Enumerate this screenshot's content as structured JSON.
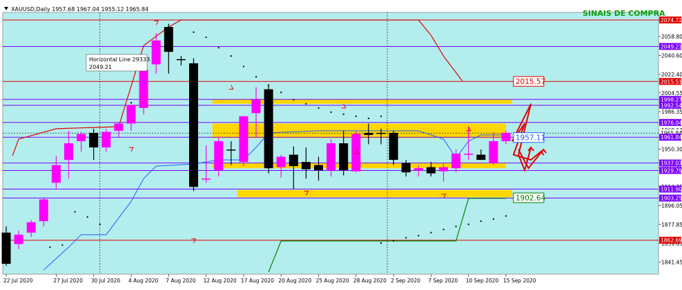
{
  "header": {
    "symbol_info": "XAUUSD,Daily  1957.68 1967.04 1955.12 1965.84",
    "signal_text": "SINAIS DE COMPRA"
  },
  "tooltip": {
    "line1": "Horizontal Line 29333",
    "line2": "2049.21"
  },
  "colors": {
    "background": "#b4eded",
    "bull": "#ff00ff",
    "bear": "#000000",
    "zone": "#ffd700",
    "red_line": "#e00000",
    "purple_line": "#7b00ff",
    "green_line": "#008000",
    "blue_line": "#1f5fff"
  },
  "chart_data": {
    "type": "candlestick",
    "ylim": [
      1830,
      2082
    ],
    "y_ticks": [
      "2074.72",
      "2058.80",
      "2040.60",
      "2022.40",
      "2004.55",
      "1986.35",
      "1968.50",
      "1950.30",
      "1932.45",
      "1914.25",
      "1896.05",
      "1877.85",
      "1859.65",
      "1841.45"
    ],
    "x_tick_labels": [
      {
        "i": 0,
        "label": "22 Jul 2020"
      },
      {
        "i": 4,
        "label": "27 Jul 2020"
      },
      {
        "i": 7,
        "label": "30 Jul 2020"
      },
      {
        "i": 10,
        "label": "4 Aug 2020"
      },
      {
        "i": 13,
        "label": "7 Aug 2020"
      },
      {
        "i": 16,
        "label": "12 Aug 2020"
      },
      {
        "i": 19,
        "label": "17 Aug 2020"
      },
      {
        "i": 22,
        "label": "20 Aug 2020"
      },
      {
        "i": 25,
        "label": "25 Aug 2020"
      },
      {
        "i": 28,
        "label": "28 Aug 2020"
      },
      {
        "i": 31,
        "label": "2 Sep 2020"
      },
      {
        "i": 34,
        "label": "7 Sep 2020"
      },
      {
        "i": 37,
        "label": "10 Sep 2020"
      },
      {
        "i": 40,
        "label": "15 Sep 2020"
      }
    ],
    "candles": [
      [
        1870,
        1876,
        1838,
        1840
      ],
      [
        1859,
        1872,
        1854,
        1868
      ],
      [
        1870,
        1882,
        1866,
        1880
      ],
      [
        1881,
        1904,
        1876,
        1902
      ],
      [
        1918,
        1944,
        1912,
        1935
      ],
      [
        1940,
        1968,
        1922,
        1956
      ],
      [
        1958,
        1967,
        1948,
        1965
      ],
      [
        1966,
        1970,
        1940,
        1952
      ],
      [
        1952,
        1970,
        1948,
        1967
      ],
      [
        1968,
        1975,
        1962,
        1975
      ],
      [
        1975,
        1993,
        1968,
        1993
      ],
      [
        1990,
        2030,
        1984,
        2027
      ],
      [
        2032,
        2062,
        2023,
        2055
      ],
      [
        2068,
        2071,
        2023,
        2044
      ],
      [
        2037,
        2040,
        2031,
        2036
      ],
      [
        2033,
        2038,
        1910,
        1914
      ],
      [
        1921,
        1954,
        1918,
        1922
      ],
      [
        1930,
        1962,
        1924,
        1958
      ],
      [
        1950,
        1958,
        1935,
        1949
      ],
      [
        1938,
        1982,
        1934,
        1982
      ],
      [
        1985,
        2010,
        1962,
        1998
      ],
      [
        2008,
        2012,
        1927,
        1932
      ],
      [
        1933,
        1945,
        1923,
        1943
      ],
      [
        1945,
        1953,
        1912,
        1934
      ],
      [
        1938,
        1952,
        1922,
        1931
      ],
      [
        1935,
        1943,
        1920,
        1930
      ],
      [
        1930,
        1960,
        1924,
        1956
      ],
      [
        1956,
        1968,
        1925,
        1930
      ],
      [
        1929,
        1968,
        1928,
        1965
      ],
      [
        1966,
        1975,
        1955,
        1964
      ],
      [
        1966,
        1970,
        1955,
        1965
      ],
      [
        1966,
        1968,
        1935,
        1940
      ],
      [
        1937,
        1940,
        1924,
        1928
      ],
      [
        1930,
        1935,
        1924,
        1932
      ],
      [
        1933,
        1938,
        1924,
        1927
      ],
      [
        1929,
        1937,
        1919,
        1933
      ],
      [
        1932,
        1950,
        1928,
        1946
      ],
      [
        1946,
        1972,
        1940,
        1946
      ],
      [
        1945,
        1950,
        1940,
        1940
      ],
      [
        1937,
        1966,
        1935,
        1958
      ],
      [
        1958,
        1968,
        1955,
        1966
      ]
    ],
    "horizontal_lines": [
      {
        "price": 2074.72,
        "color": "red",
        "label": "2074.72",
        "tag": "red"
      },
      {
        "price": 2049.21,
        "color": "purple",
        "label": "2049.21",
        "tag": "purple"
      },
      {
        "price": 2015.51,
        "color": "red",
        "label": "2015.51",
        "tag": "red"
      },
      {
        "price": 1998.27,
        "color": "purple",
        "label": "1998.27",
        "tag": "purple"
      },
      {
        "price": 1992.54,
        "color": "purple",
        "label": "1992.54",
        "tag": "purple"
      },
      {
        "price": 1976.04,
        "color": "purple",
        "label": "1976.04",
        "tag": "purple"
      },
      {
        "price": 1965.84,
        "color": "black",
        "label": "1965.84",
        "tag": "white"
      },
      {
        "price": 1961.84,
        "color": "purple",
        "label": "1961.84",
        "tag": "purple"
      },
      {
        "price": 1937.03,
        "color": "purple",
        "label": "1937.03",
        "tag": "purple"
      },
      {
        "price": 1929.79,
        "color": "purple",
        "label": "1929.79",
        "tag": "purple"
      },
      {
        "price": 1911.9,
        "color": "purple",
        "label": "1911.90",
        "tag": "purple"
      },
      {
        "price": 1903.25,
        "color": "purple",
        "label": "1903.25",
        "tag": "purple"
      },
      {
        "price": 1862.69,
        "color": "red",
        "label": "1862.69",
        "tag": "red"
      }
    ],
    "zones": [
      {
        "top": 1998,
        "bottom": 1994,
        "i0": 16.5,
        "i1": 40.5
      },
      {
        "top": 1975,
        "bottom": 1961,
        "i0": 16.5,
        "i1": 40
      },
      {
        "top": 1937,
        "bottom": 1932,
        "i0": 16.5,
        "i1": 40
      },
      {
        "top": 1911,
        "bottom": 1904,
        "i0": 18.5,
        "i1": 40.5
      }
    ],
    "zone_labels": [
      {
        "text": "2015.57",
        "price": 2015.57,
        "i": 40.6,
        "color": "red"
      },
      {
        "text": "1957.11",
        "price": 1961.5,
        "i": 40.6,
        "color": "blue"
      },
      {
        "text": "1902.64",
        "price": 1903.5,
        "i": 40.6,
        "color": "green"
      }
    ],
    "red_curve": [
      [
        0.5,
        1944
      ],
      [
        1,
        1960
      ],
      [
        4,
        1970
      ],
      [
        9,
        1972
      ],
      [
        11,
        2050
      ],
      [
        13,
        2068
      ],
      [
        14,
        2074.7
      ],
      [
        33,
        2074.7
      ],
      [
        34,
        2060
      ],
      [
        35,
        2040
      ],
      [
        36.5,
        2016
      ]
    ],
    "green_curve": [
      [
        21,
        1832
      ],
      [
        22,
        1862
      ],
      [
        35,
        1862
      ],
      [
        36,
        1862
      ],
      [
        37,
        1903
      ],
      [
        40,
        1903
      ]
    ],
    "blue_curve": [
      [
        3,
        1834
      ],
      [
        5,
        1856
      ],
      [
        6,
        1868
      ],
      [
        8,
        1868
      ],
      [
        10,
        1900
      ],
      [
        11,
        1922
      ],
      [
        12,
        1934
      ],
      [
        15,
        1936
      ],
      [
        16,
        1938
      ],
      [
        17,
        1940
      ],
      [
        19,
        1940
      ],
      [
        20,
        1952
      ],
      [
        21,
        1966
      ],
      [
        25,
        1968
      ],
      [
        30,
        1968
      ],
      [
        33,
        1968
      ],
      [
        35,
        1960
      ],
      [
        36,
        1942
      ],
      [
        37,
        1958
      ],
      [
        38,
        1964
      ],
      [
        40,
        1964
      ]
    ],
    "psar_dots": [
      [
        15,
        2063
      ],
      [
        16,
        2058
      ],
      [
        17,
        2048
      ],
      [
        18,
        2040
      ],
      [
        19,
        2030
      ],
      [
        20,
        2020
      ],
      [
        21,
        2012
      ],
      [
        22,
        2005
      ],
      [
        23,
        1998
      ],
      [
        24,
        1994
      ],
      [
        25,
        1990
      ],
      [
        26,
        1986
      ],
      [
        27,
        1984
      ],
      [
        28,
        1982
      ],
      [
        29,
        1980
      ],
      [
        30,
        1982
      ],
      [
        10,
        1995
      ],
      [
        7.5,
        1878
      ],
      [
        6.5,
        1885
      ],
      [
        5.5,
        1890
      ],
      [
        4.5,
        1858
      ],
      [
        3.5,
        1856
      ],
      [
        30,
        1860
      ],
      [
        31,
        1862
      ],
      [
        32,
        1865
      ],
      [
        33,
        1867
      ],
      [
        34,
        1870
      ],
      [
        35,
        1873
      ],
      [
        36,
        1876
      ],
      [
        37,
        1878
      ],
      [
        38,
        1881
      ],
      [
        39,
        1883
      ],
      [
        40,
        1886
      ]
    ],
    "arrows": [
      {
        "i": 24,
        "price": 1906,
        "dir": "down"
      },
      {
        "i": 35,
        "price": 1903,
        "dir": "down"
      },
      {
        "i": 28,
        "price": 1950,
        "dir": "up"
      },
      {
        "i": 37,
        "price": 1972,
        "dir": "up"
      },
      {
        "i": 15,
        "price": 1860,
        "dir": "down"
      },
      {
        "i": 12,
        "price": 2070,
        "dir": "down"
      },
      {
        "i": 18,
        "price": 2012,
        "dir": "up"
      },
      {
        "i": 27,
        "price": 1994,
        "dir": "up"
      },
      {
        "i": 10,
        "price": 1948,
        "dir": "down"
      }
    ],
    "zigzag": [
      [
        [
          40.5,
          1958
        ],
        [
          42,
          1994
        ],
        [
          41,
          1945
        ],
        [
          41.5,
          1930
        ],
        [
          42,
          1952
        ]
      ],
      [
        [
          40.5,
          1958
        ],
        [
          41.5,
          1975
        ],
        [
          40.6,
          1945
        ],
        [
          42,
          1940
        ],
        [
          42.8,
          1948
        ]
      ],
      [
        [
          41,
          1950
        ],
        [
          41.8,
          1932
        ],
        [
          43,
          1950
        ]
      ]
    ],
    "vlines_dotted": [
      7.5,
      30.5
    ]
  }
}
